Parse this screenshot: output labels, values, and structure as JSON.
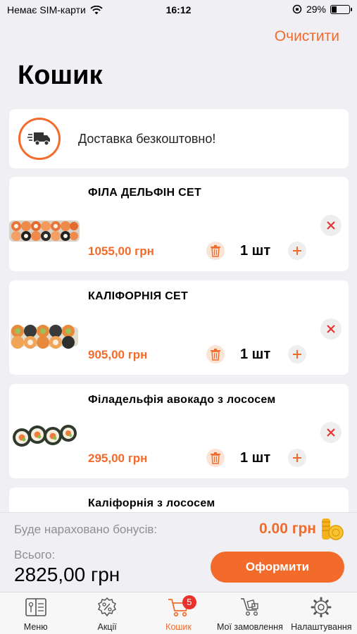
{
  "status_bar": {
    "carrier": "Немає SIM-карти",
    "time": "16:12",
    "battery": "29%",
    "battery_level": 0.29
  },
  "header": {
    "clear_label": "Очистити",
    "title": "Кошик"
  },
  "delivery": {
    "icon": "delivery-truck-icon",
    "text": "Доставка безкоштовно!"
  },
  "items": [
    {
      "name": "ФІЛА ДЕЛЬФІН СЕТ",
      "price": "1055,00 грн",
      "qty": "1 шт"
    },
    {
      "name": "КАЛІФОРНІЯ СЕТ",
      "price": "905,00 грн",
      "qty": "1 шт"
    },
    {
      "name": "Філадельфія авокадо з лососем",
      "price": "295,00 грн",
      "qty": "1 шт"
    },
    {
      "name": "Каліфорнія з лососем"
    }
  ],
  "summary": {
    "bonus_label": "Буде нараховано бонусів:",
    "bonus_value": "0.00 грн",
    "total_label": "Всього:",
    "total_value": "2825,00 грн",
    "checkout_label": "Оформити"
  },
  "tabs": [
    {
      "label": "Меню",
      "icon": "menu-book-icon"
    },
    {
      "label": "Акції",
      "icon": "discount-icon"
    },
    {
      "label": "Кошик",
      "icon": "cart-icon",
      "badge": "5",
      "active": true
    },
    {
      "label": "Мої замовлення",
      "icon": "orders-cart-icon"
    },
    {
      "label": "Налаштування",
      "icon": "gear-icon"
    }
  ],
  "colors": {
    "accent": "#f26b2a",
    "background": "#efeff4",
    "badge": "#e8322d"
  }
}
